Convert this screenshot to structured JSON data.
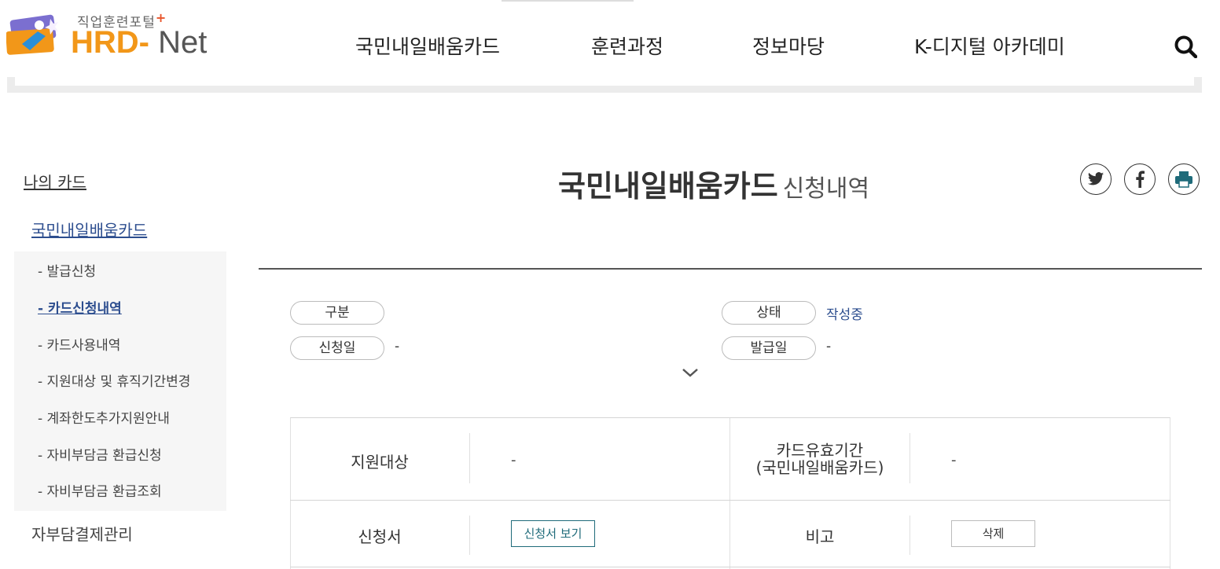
{
  "header": {
    "logo_kr": "직업훈련포털",
    "logo_plus": "+",
    "logo_hrd": "HRD-",
    "logo_net": "Net",
    "nav": [
      "국민내일배움카드",
      "훈련과정",
      "정보마당",
      "K-디지털 아카데미"
    ]
  },
  "sidebar": {
    "title": "나의 카드",
    "sub_title": "국민내일배움카드",
    "items": [
      {
        "label": "- 발급신청",
        "active": false
      },
      {
        "label": "- 카드신청내역",
        "active": true
      },
      {
        "label": "- 카드사용내역",
        "active": false
      },
      {
        "label": "- 지원대상 및 휴직기간변경",
        "active": false
      },
      {
        "label": "- 계좌한도추가지원안내",
        "active": false
      },
      {
        "label": "- 자비부담금 환급신청",
        "active": false
      },
      {
        "label": "- 자비부담금 환급조회",
        "active": false
      }
    ],
    "other": "자부담결제관리"
  },
  "page": {
    "title": "국민내일배움카드",
    "title_sub": "신청내역"
  },
  "summary": {
    "category_label": "구분",
    "category_value": "",
    "status_label": "상태",
    "status_value": "작성중",
    "apply_date_label": "신청일",
    "apply_date_value": "-",
    "issue_date_label": "발급일",
    "issue_date_value": "-"
  },
  "table": {
    "support_target_label": "지원대상",
    "support_target_value": "-",
    "validity_label_1": "카드유효기간",
    "validity_label_2": "(국민내일배움카드)",
    "validity_value": "-",
    "application_label": "신청서",
    "view_button": "신청서 보기",
    "note_label": "비고",
    "delete_button": "삭제"
  },
  "colors": {
    "brand_orange": "#f29719",
    "active_blue": "#2d4e8f",
    "view_button": "#1f6b7a"
  },
  "icons": [
    "search-icon",
    "twitter-icon",
    "facebook-icon",
    "print-icon",
    "chevron-down-icon"
  ]
}
